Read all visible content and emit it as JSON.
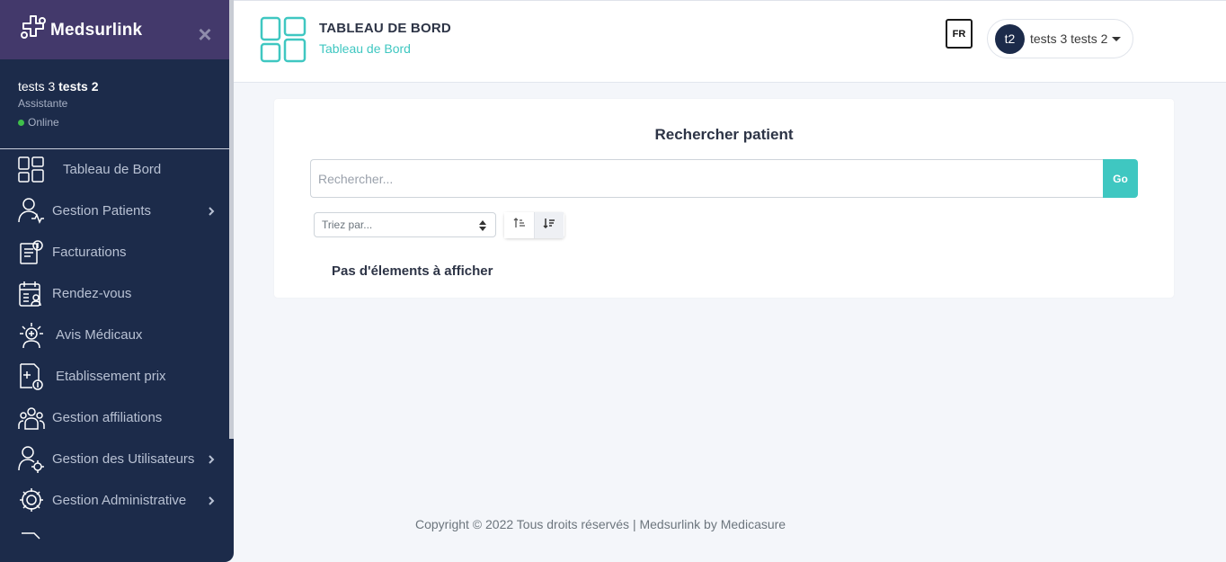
{
  "brand": {
    "name": "Medsurlink",
    "close_symbol": "×"
  },
  "user_panel": {
    "first_name": "tests 3",
    "last_name": "tests 2",
    "role": "Assistante",
    "status": "Online",
    "status_color": "#3fbf4a"
  },
  "sidebar": {
    "items": [
      {
        "label": "Tableau de Bord",
        "icon": "dashboard-icon",
        "has_submenu": false
      },
      {
        "label": "Gestion Patients",
        "icon": "patient-icon",
        "has_submenu": true
      },
      {
        "label": "Facturations",
        "icon": "invoice-icon",
        "has_submenu": false
      },
      {
        "label": "Rendez-vous",
        "icon": "calendar-icon",
        "has_submenu": false
      },
      {
        "label": "Avis Médicaux",
        "icon": "medical-advice-icon",
        "has_submenu": false
      },
      {
        "label": "Etablissement prix",
        "icon": "price-document-icon",
        "has_submenu": false
      },
      {
        "label": "Gestion affiliations",
        "icon": "group-icon",
        "has_submenu": false
      },
      {
        "label": "Gestion des Utilisateurs",
        "icon": "user-settings-icon",
        "has_submenu": true
      },
      {
        "label": "Gestion Administrative",
        "icon": "admin-gear-icon",
        "has_submenu": true
      }
    ]
  },
  "header": {
    "title": "TABLEAU DE BORD",
    "subtitle": "Tableau de Bord",
    "language": "FR",
    "avatar_initials": "t2",
    "user_display": "tests 3 tests 2"
  },
  "main": {
    "card_title": "Rechercher patient",
    "search": {
      "placeholder": "Rechercher...",
      "value": ""
    },
    "go_label": "Go",
    "sort": {
      "placeholder": "Triez par..."
    },
    "empty_message": "Pas d'élements à afficher"
  },
  "footer": {
    "text": "Copyright © 2022 Tous droits réservés | Medsurlink by Medicasure"
  },
  "colors": {
    "sidebar_bg": "#1c2b4a",
    "sidebar_header_bg": "#43396b",
    "accent": "#3fc7c1",
    "title": "#2d3446"
  }
}
